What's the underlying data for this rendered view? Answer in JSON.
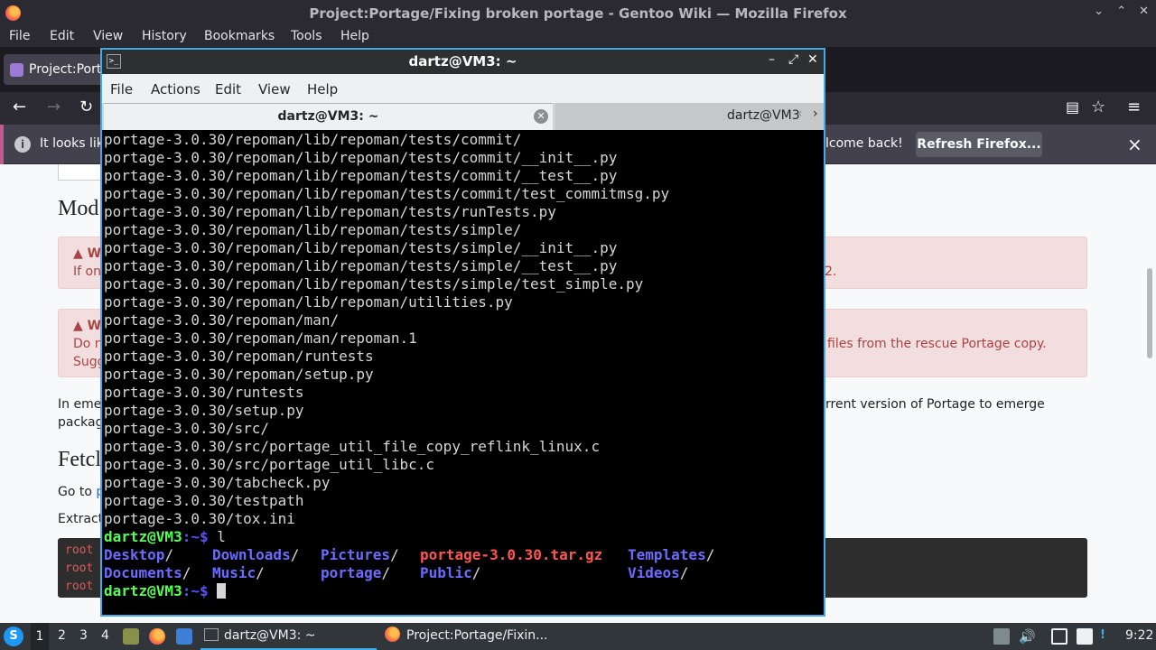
{
  "firefox": {
    "window_title": "Project:Portage/Fixing broken portage - Gentoo Wiki — Mozilla Firefox",
    "menu": [
      "File",
      "Edit",
      "View",
      "History",
      "Bookmarks",
      "Tools",
      "Help"
    ],
    "tab_title": "Project:Porta",
    "notification": {
      "text_left": "It looks lik",
      "text_right": "lcome back!",
      "button": "Refresh Firefox...",
      "close": "×"
    },
    "controls": {
      "minimize": "⌄",
      "maximize": "⌃",
      "close": "✕"
    }
  },
  "wiki": {
    "heading_mod": "Mod",
    "alert1_title": "W",
    "alert1_text_left": "If on",
    "alert1_text_right": "2.",
    "alert2_title": "W",
    "alert2_line1_left": "Do n",
    "alert2_line1_right": "files from the rescue Portage copy.",
    "alert2_line2_left": "Sugg",
    "para_left": "In eme",
    "para_right": "rrent version of Portage to emerge",
    "para2_left": "packag",
    "heading_fetch": "Fetcl",
    "goto_left": "Go to",
    "goto_link": "p",
    "extract_left": "Extract",
    "code_lines": [
      "root",
      "root",
      "root"
    ]
  },
  "terminal": {
    "title": "dartz@VM3: ~",
    "menu": [
      "File",
      "Actions",
      "Edit",
      "View",
      "Help"
    ],
    "tab1": "dartz@VM3: ~",
    "tab2": "dartz@VM3",
    "lines": [
      "portage-3.0.30/repoman/lib/repoman/tests/commit/",
      "portage-3.0.30/repoman/lib/repoman/tests/commit/__init__.py",
      "portage-3.0.30/repoman/lib/repoman/tests/commit/__test__.py",
      "portage-3.0.30/repoman/lib/repoman/tests/commit/test_commitmsg.py",
      "portage-3.0.30/repoman/lib/repoman/tests/runTests.py",
      "portage-3.0.30/repoman/lib/repoman/tests/simple/",
      "portage-3.0.30/repoman/lib/repoman/tests/simple/__init__.py",
      "portage-3.0.30/repoman/lib/repoman/tests/simple/__test__.py",
      "portage-3.0.30/repoman/lib/repoman/tests/simple/test_simple.py",
      "portage-3.0.30/repoman/lib/repoman/utilities.py",
      "portage-3.0.30/repoman/man/",
      "portage-3.0.30/repoman/man/repoman.1",
      "portage-3.0.30/repoman/runtests",
      "portage-3.0.30/repoman/setup.py",
      "portage-3.0.30/runtests",
      "portage-3.0.30/setup.py",
      "portage-3.0.30/src/",
      "portage-3.0.30/src/portage_util_file_copy_reflink_linux.c",
      "portage-3.0.30/src/portage_util_libc.c",
      "portage-3.0.30/tabcheck.py",
      "portage-3.0.30/testpath",
      "portage-3.0.30/tox.ini"
    ],
    "prompt_user": "dartz@VM3",
    "prompt_path": ":~$ ",
    "command": "l",
    "ls_row1": {
      "a": "Desktop",
      "b": "Downloads",
      "c": "Pictures",
      "d": "portage-3.0.30.tar.gz",
      "e": "Templates"
    },
    "ls_row2": {
      "a": "Documents",
      "b": "Music",
      "c": "portage",
      "d": "Public",
      "e": "Videos"
    },
    "slash": "/"
  },
  "taskbar": {
    "workspaces": [
      "1",
      "2",
      "3",
      "4"
    ],
    "task_terminal": "dartz@VM3: ~",
    "task_firefox": "Project:Portage/Fixin...",
    "clock": "9:22"
  },
  "colors": {
    "terminal_prompt": "#54ff54",
    "terminal_dir": "#6b6bff",
    "terminal_archive": "#ff5454",
    "focus_accent": "#3daee9"
  }
}
